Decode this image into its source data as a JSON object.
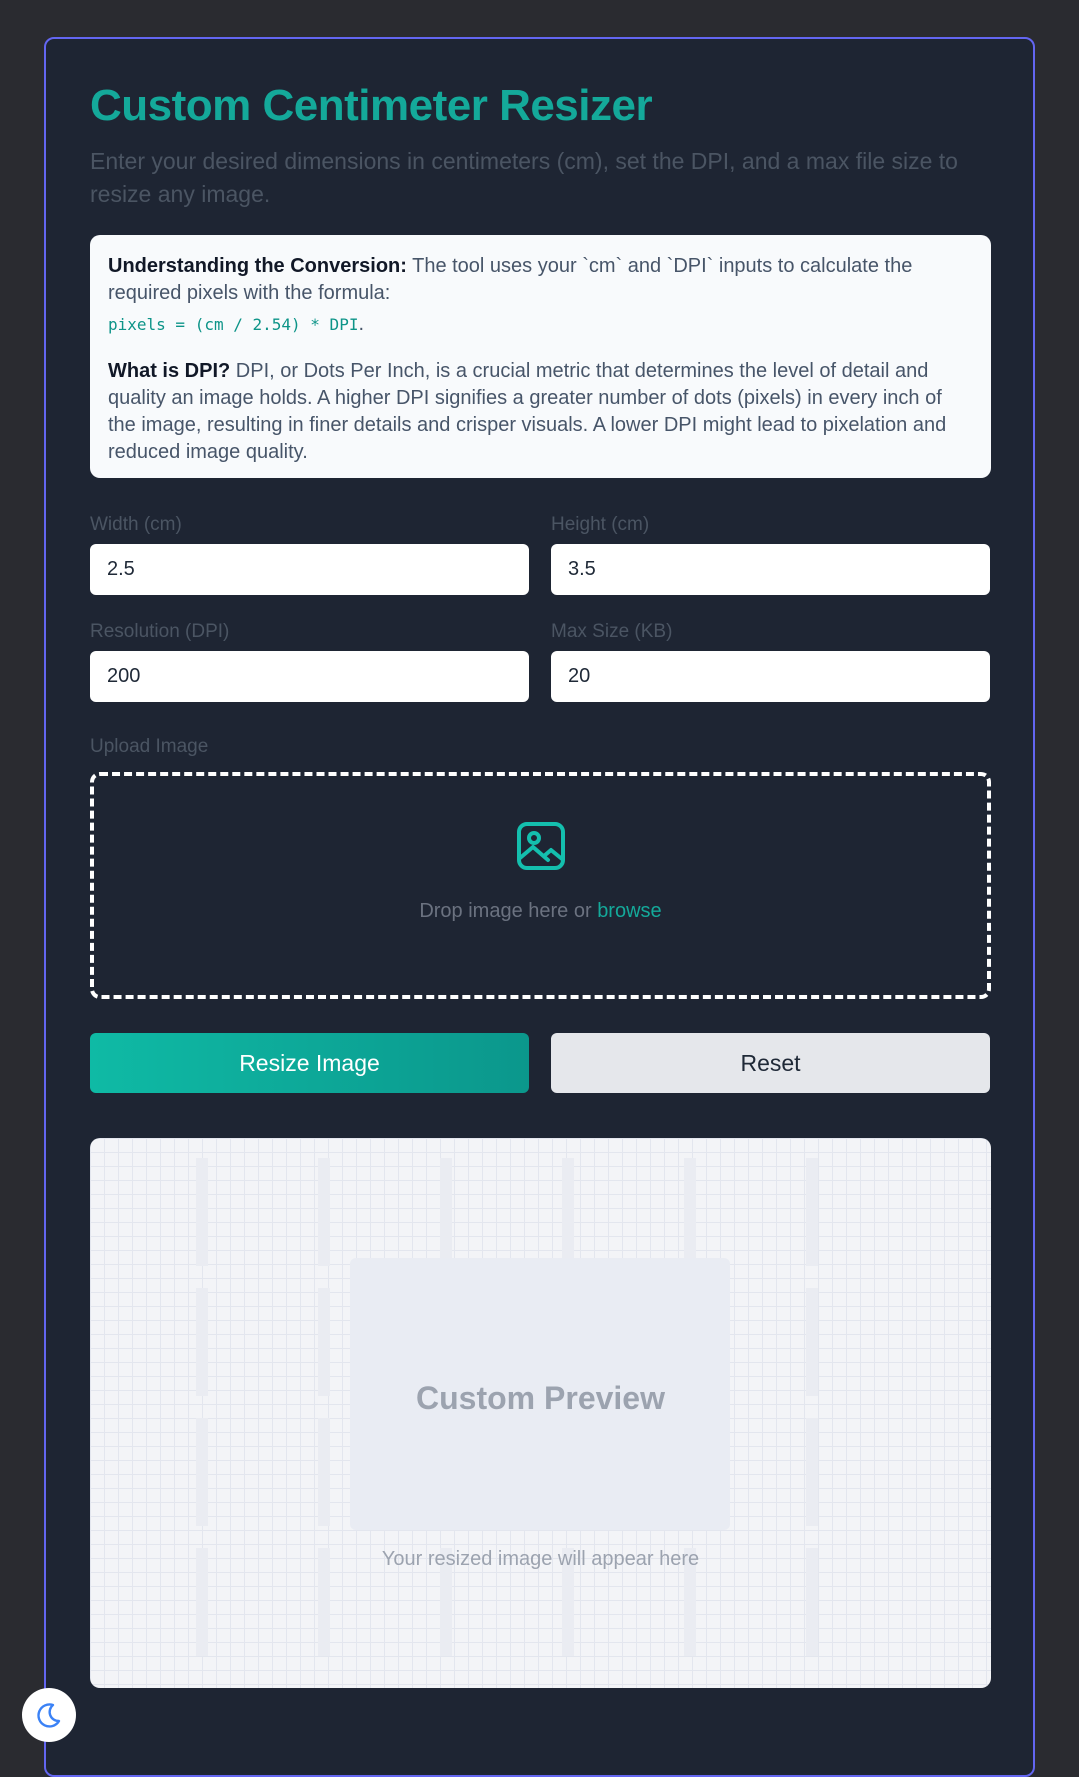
{
  "header": {
    "title": "Custom Centimeter Resizer",
    "subtitle": "Enter your desired dimensions in centimeters (cm), set the DPI, and a max file size to resize any image."
  },
  "info": {
    "conversion_heading": "Understanding the Conversion:",
    "conversion_text": " The tool uses your `cm` and `DPI` inputs to calculate the required pixels with the formula:",
    "formula": "pixels = (cm / 2.54) * DPI",
    "formula_end": ".",
    "dpi_heading": "What is DPI?",
    "dpi_text": " DPI, or Dots Per Inch, is a crucial metric that determines the level of detail and quality an image holds. A higher DPI signifies a greater number of dots (pixels) in every inch of the image, resulting in finer details and crisper visuals. A lower DPI might lead to pixelation and reduced image quality."
  },
  "form": {
    "width": {
      "label": "Width (cm)",
      "value": "2.5"
    },
    "height": {
      "label": "Height (cm)",
      "value": "3.5"
    },
    "dpi": {
      "label": "Resolution (DPI)",
      "value": "200"
    },
    "max_size": {
      "label": "Max Size (KB)",
      "value": "20"
    }
  },
  "upload": {
    "label": "Upload Image",
    "drop_text": "Drop image here or ",
    "browse_text": "browse",
    "icon": "image-icon"
  },
  "actions": {
    "resize_label": "Resize Image",
    "reset_label": "Reset"
  },
  "preview": {
    "title": "Custom Preview",
    "subtitle": "Your resized image will appear here"
  },
  "theme_toggle": {
    "icon": "moon-icon"
  },
  "colors": {
    "accent": "#14a99a",
    "card_border": "#6366f1",
    "card_bg": "#1e2533",
    "page_bg": "#2a2b30"
  }
}
